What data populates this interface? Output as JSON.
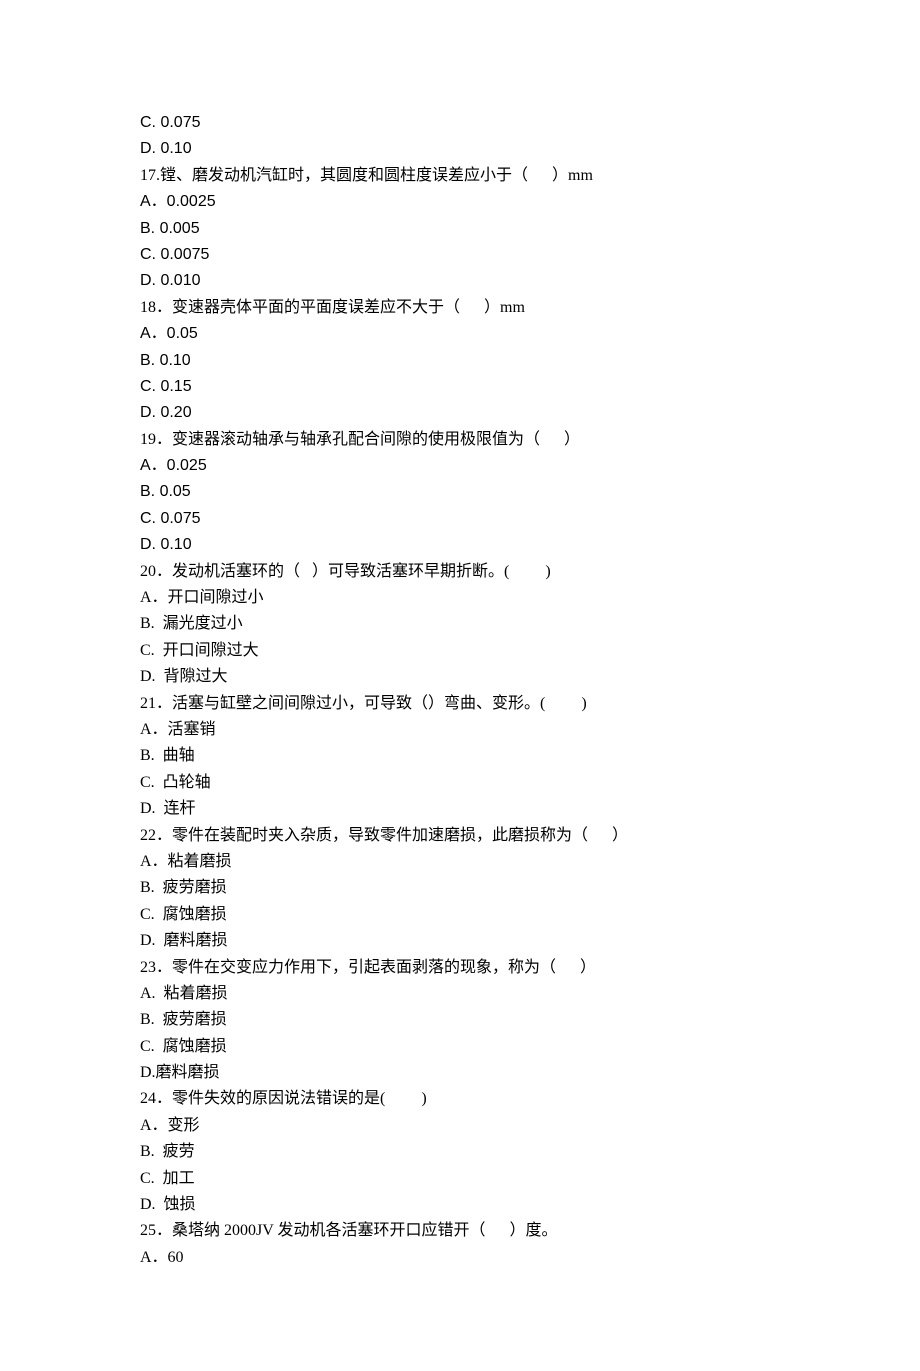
{
  "lines": [
    {
      "class": "latin",
      "text": "C. 0.075"
    },
    {
      "class": "latin",
      "text": "D. 0.10"
    },
    {
      "class": "",
      "text": "17.镗、磨发动机汽缸时，其圆度和圆柱度误差应小于（      ）mm"
    },
    {
      "class": "latin",
      "text": "A．0.0025"
    },
    {
      "class": "latin",
      "text": "B. 0.005"
    },
    {
      "class": "latin",
      "text": "C. 0.0075"
    },
    {
      "class": "latin",
      "text": "D. 0.010"
    },
    {
      "class": "",
      "text": "18．变速器壳体平面的平面度误差应不大于（      ）mm"
    },
    {
      "class": "latin",
      "text": "A．0.05"
    },
    {
      "class": "latin",
      "text": "B. 0.10"
    },
    {
      "class": "latin",
      "text": "C. 0.15"
    },
    {
      "class": "latin",
      "text": "D. 0.20"
    },
    {
      "class": "",
      "text": "19．变速器滚动轴承与轴承孔配合间隙的使用极限值为（      ）"
    },
    {
      "class": "latin",
      "text": "A．0.025"
    },
    {
      "class": "latin",
      "text": "B. 0.05"
    },
    {
      "class": "latin",
      "text": "C. 0.075"
    },
    {
      "class": "latin",
      "text": "D. 0.10"
    },
    {
      "class": "",
      "text": "20．发动机活塞环的（   ）可导致活塞环早期折断。(         )"
    },
    {
      "class": "",
      "text": "A．开口间隙过小"
    },
    {
      "class": "",
      "text": "B.  漏光度过小"
    },
    {
      "class": "",
      "text": "C.  开口间隙过大"
    },
    {
      "class": "",
      "text": "D.  背隙过大"
    },
    {
      "class": "",
      "text": "21．活塞与缸壁之间间隙过小，可导致（）弯曲、变形。(         )"
    },
    {
      "class": "",
      "text": "A．活塞销"
    },
    {
      "class": "",
      "text": "B.  曲轴"
    },
    {
      "class": "",
      "text": "C.  凸轮轴"
    },
    {
      "class": "",
      "text": "D.  连杆"
    },
    {
      "class": "",
      "text": "22．零件在装配时夹入杂质，导致零件加速磨损，此磨损称为（      ）"
    },
    {
      "class": "",
      "text": "A．粘着磨损"
    },
    {
      "class": "",
      "text": "B.  疲劳磨损"
    },
    {
      "class": "",
      "text": "C.  腐蚀磨损"
    },
    {
      "class": "",
      "text": "D.  磨料磨损"
    },
    {
      "class": "",
      "text": "23．零件在交变应力作用下，引起表面剥落的现象，称为（      ）"
    },
    {
      "class": "",
      "text": "A.  粘着磨损"
    },
    {
      "class": "",
      "text": "B.  疲劳磨损"
    },
    {
      "class": "",
      "text": "C.  腐蚀磨损"
    },
    {
      "class": "",
      "text": "D.磨料磨损"
    },
    {
      "class": "",
      "text": "24．零件失效的原因说法错误的是(         )"
    },
    {
      "class": "",
      "text": "A．变形"
    },
    {
      "class": "",
      "text": "B.  疲劳"
    },
    {
      "class": "",
      "text": "C.  加工"
    },
    {
      "class": "",
      "text": "D.  蚀损"
    },
    {
      "class": "",
      "text": "25．桑塔纳 2000JV 发动机各活塞环开口应错开（      ）度。"
    },
    {
      "class": "",
      "text": "A．60"
    }
  ]
}
